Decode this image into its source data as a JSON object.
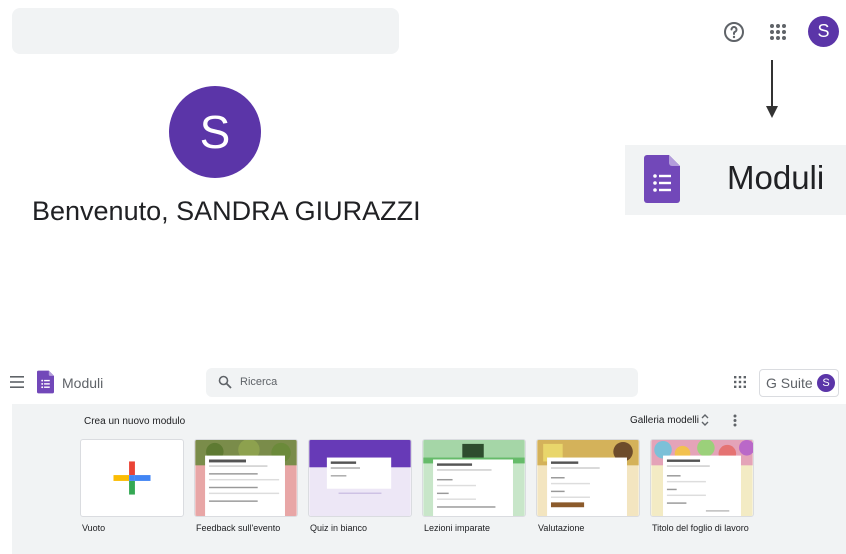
{
  "top": {
    "search_placeholder": "",
    "help_icon": "help-circle-icon",
    "apps_icon": "apps-grid-icon",
    "avatar_letter": "S"
  },
  "welcome": {
    "avatar_letter": "S",
    "text": "Benvenuto, SANDRA GIURAZZI"
  },
  "banner": {
    "label": "Moduli",
    "logo_icon": "google-forms-icon"
  },
  "app": {
    "title": "Moduli",
    "search_placeholder": "Ricerca",
    "gsuite_label": "G Suite",
    "avatar_letter": "S"
  },
  "gallery": {
    "create_label": "Crea un nuovo modulo",
    "gallery_label": "Galleria modelli",
    "templates": [
      {
        "label": "Vuoto"
      },
      {
        "label": "Feedback sull'evento"
      },
      {
        "label": "Quiz in bianco"
      },
      {
        "label": "Lezioni imparate"
      },
      {
        "label": "Valutazione"
      },
      {
        "label": "Titolo del foglio di lavoro"
      }
    ]
  },
  "colors": {
    "purple": "#5b35a8",
    "forms_purple": "#7248b9",
    "gallery_bg": "#f1f3f4"
  }
}
